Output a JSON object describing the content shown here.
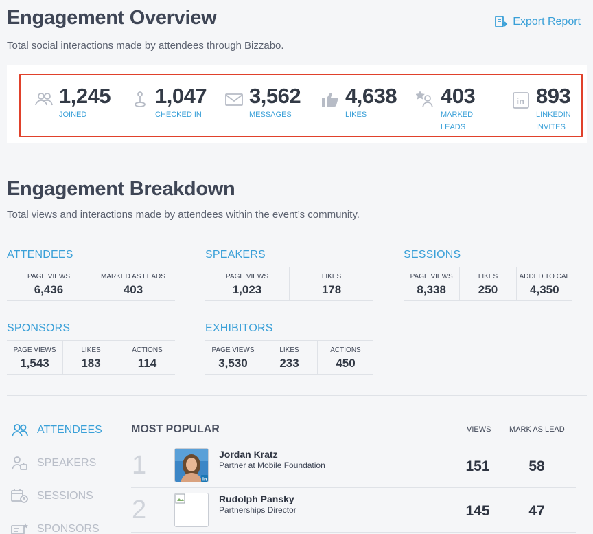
{
  "overview": {
    "title": "Engagement Overview",
    "subtitle": "Total social interactions made by attendees through Bizzabo.",
    "export_label": "Export Report",
    "stats": [
      {
        "icon": "people-icon",
        "value": "1,245",
        "label1": "JOINED",
        "label2": ""
      },
      {
        "icon": "location-pin-icon",
        "value": "1,047",
        "label1": "CHECKED IN",
        "label2": ""
      },
      {
        "icon": "envelope-icon",
        "value": "3,562",
        "label1": "MESSAGES",
        "label2": ""
      },
      {
        "icon": "thumbs-up-icon",
        "value": "4,638",
        "label1": "LIKES",
        "label2": ""
      },
      {
        "icon": "user-star-icon",
        "value": "403",
        "label1": "MARKED",
        "label2": "LEADS"
      },
      {
        "icon": "linkedin-icon",
        "value": "893",
        "label1": "LINKEDIN",
        "label2": "INVITES"
      }
    ]
  },
  "breakdown": {
    "title": "Engagement Breakdown",
    "subtitle": "Total views and interactions made by attendees within the event’s community.",
    "attendees": {
      "title": "ATTENDEES",
      "cells": [
        {
          "label": "PAGE VIEWS",
          "value": "6,436"
        },
        {
          "label": "MARKED AS LEADS",
          "value": "403"
        }
      ]
    },
    "speakers": {
      "title": "SPEAKERS",
      "cells": [
        {
          "label": "PAGE VIEWS",
          "value": "1,023"
        },
        {
          "label": "LIKES",
          "value": "178"
        }
      ]
    },
    "sessions": {
      "title": "SESSIONS",
      "cells": [
        {
          "label": "PAGE VIEWS",
          "value": "8,338"
        },
        {
          "label": "LIKES",
          "value": "250"
        },
        {
          "label": "ADDED TO CAL",
          "value": "4,350"
        }
      ]
    },
    "sponsors": {
      "title": "SPONSORS",
      "cells": [
        {
          "label": "PAGE VIEWS",
          "value": "1,543"
        },
        {
          "label": "LIKES",
          "value": "183"
        },
        {
          "label": "ACTIONS",
          "value": "114"
        }
      ]
    },
    "exhibitors": {
      "title": "EXHIBITORS",
      "cells": [
        {
          "label": "PAGE VIEWS",
          "value": "3,530"
        },
        {
          "label": "LIKES",
          "value": "233"
        },
        {
          "label": "ACTIONS",
          "value": "450"
        }
      ]
    }
  },
  "sidebar": {
    "items": [
      {
        "label": "ATTENDEES",
        "icon": "attendees-icon",
        "active": true
      },
      {
        "label": "SPEAKERS",
        "icon": "speakers-icon",
        "active": false
      },
      {
        "label": "SESSIONS",
        "icon": "sessions-icon",
        "active": false
      },
      {
        "label": "SPONSORS",
        "icon": "sponsors-icon",
        "active": false
      }
    ]
  },
  "popular": {
    "title": "MOST POPULAR",
    "col_views": "VIEWS",
    "col_lead": "MARK AS LEAD",
    "rows": [
      {
        "rank": "1",
        "name": "Jordan Kratz",
        "title": "Partner at Mobile Foundation",
        "views": "151",
        "leads": "58"
      },
      {
        "rank": "2",
        "name": "Rudolph Pansky",
        "title": "Partnerships Director",
        "views": "145",
        "leads": "47"
      }
    ]
  },
  "colors": {
    "accent": "#3aa0d8",
    "highlight": "#e0412b",
    "heading": "#3f4656"
  }
}
